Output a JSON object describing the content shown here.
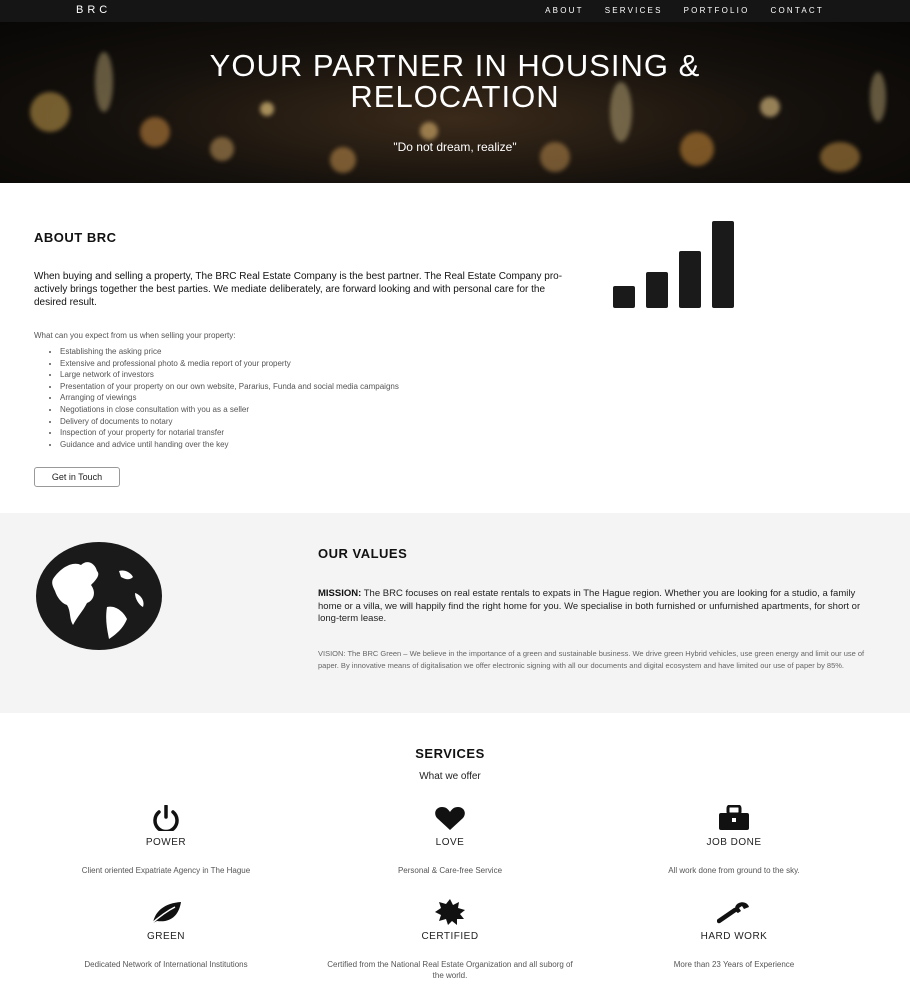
{
  "nav": {
    "brand": "BRC",
    "items": [
      {
        "label": "ABOUT"
      },
      {
        "label": "SERVICES"
      },
      {
        "label": "PORTFOLIO"
      },
      {
        "label": "CONTACT"
      }
    ]
  },
  "hero": {
    "title_line1": "YOUR PARTNER IN HOUSING &",
    "title_line2": "RELOCATION",
    "subtitle": "\"Do not dream, realize\""
  },
  "about": {
    "heading": "ABOUT BRC",
    "lead": "When buying and selling a property, The BRC Real Estate Company is the best partner. The Real Estate Company pro-actively brings together the best parties. We mediate deliberately, are forward looking and with personal care for the desired result.",
    "expect_label": "What can you expect from us when selling your property:",
    "features": [
      "Establishing the asking price",
      "Extensive and professional photo & media report of your property",
      "Large network of investors",
      "Presentation of your property on our own website, Pararius, Funda and social media campaigns",
      "Arranging of viewings",
      "Negotiations in close consultation with you as a seller",
      "Delivery of documents to notary",
      "Inspection of your property for notarial transfer",
      "Guidance and advice until handing over the key"
    ],
    "cta": "Get in Touch",
    "icon": "bar-chart-icon"
  },
  "values": {
    "heading": "OUR VALUES",
    "icon": "globe-icon",
    "mission_label": "MISSION:",
    "mission_text": " The BRC focuses on real estate rentals to expats in The Hague region. Whether you are looking for a studio, a family home or a villa, we will happily find the right home for you. We specialise in both furnished or unfurnished apartments, for short or long-term lease.",
    "vision": "VISION: The BRC Green – We believe in the importance of a green and sustainable business. We drive green Hybrid vehicles, use green energy and limit our use of paper. By innovative means of digitalisation we offer electronic signing with all our documents and digital ecosystem and have limited our use of paper by 85%."
  },
  "services": {
    "heading": "SERVICES",
    "subheading": "What we offer",
    "items": [
      {
        "icon": "power-icon",
        "name": "POWER",
        "desc": "Client oriented Expatriate Agency in The Hague"
      },
      {
        "icon": "heart-icon",
        "name": "LOVE",
        "desc": "Personal & Care-free Service"
      },
      {
        "icon": "briefcase-icon",
        "name": "JOB DONE",
        "desc": "All work done from ground to the sky."
      },
      {
        "icon": "leaf-icon",
        "name": "GREEN",
        "desc": "Dedicated Network of International Institutions"
      },
      {
        "icon": "certified-badge-icon",
        "name": "CERTIFIED",
        "desc": "Certified from the National Real Estate Organization and all suborg of the world."
      },
      {
        "icon": "wrench-icon",
        "name": "HARD WORK",
        "desc": "More than 23 Years of Experience"
      }
    ]
  }
}
